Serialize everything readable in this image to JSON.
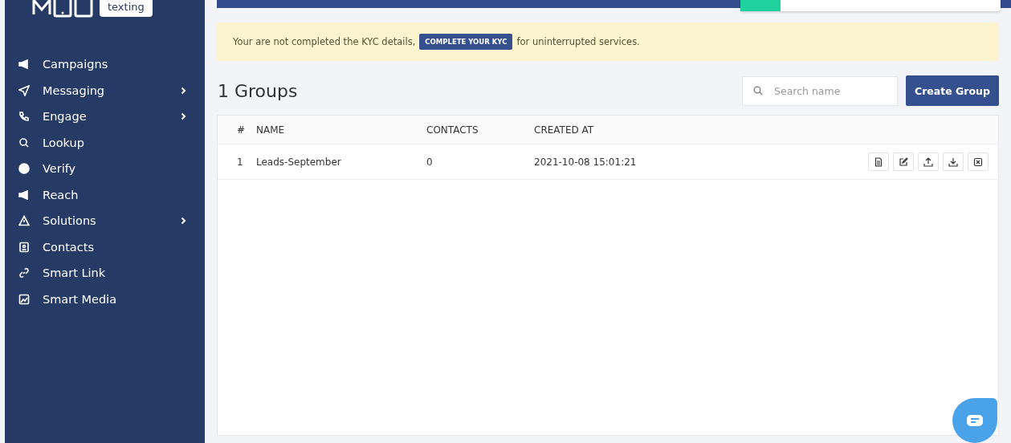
{
  "logo": {
    "text": "texting"
  },
  "sidebar": {
    "items": [
      {
        "label": "Campaigns",
        "submenu": false
      },
      {
        "label": "Messaging",
        "submenu": true
      },
      {
        "label": "Engage",
        "submenu": true
      },
      {
        "label": "Lookup",
        "submenu": false
      },
      {
        "label": "Verify",
        "submenu": false
      },
      {
        "label": "Reach",
        "submenu": false
      },
      {
        "label": "Solutions",
        "submenu": true
      },
      {
        "label": "Contacts",
        "submenu": false
      },
      {
        "label": "Smart Link",
        "submenu": false
      },
      {
        "label": "Smart Media",
        "submenu": false
      }
    ]
  },
  "kyc_banner": {
    "before": "Your are not completed the KYC details,",
    "button": "COMPLETE YOUR KYC",
    "after": "for uninterrupted services."
  },
  "heading": "1 Groups",
  "search": {
    "placeholder": "Search name"
  },
  "create_button": "Create Group",
  "table": {
    "columns": [
      "#",
      "NAME",
      "CONTACTS",
      "CREATED AT"
    ],
    "rows": [
      {
        "cells": [
          "1",
          "Leads-September",
          "0",
          "2021-10-08 15:01:21"
        ]
      }
    ]
  }
}
